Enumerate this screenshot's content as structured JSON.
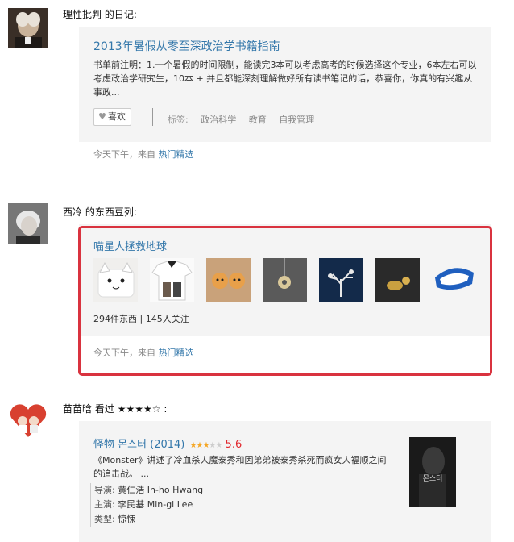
{
  "feed": {
    "item1": {
      "user": "理性批判",
      "action": "的日记:",
      "title": "2013年暑假从零至深政治学书籍指南",
      "desc": "书单前注明：1.一个暑假的时间限制，能读完3本可以考虑高考的时候选择这个专业，6本左右可以考虑政治学研究生，10本 + 并且都能深刻理解做好所有读书笔记的话，恭喜你，你真的有兴趣从事政...",
      "like_label": "喜欢",
      "tags_label": "标签:",
      "tags": [
        "政治科学",
        "教育",
        "自我管理"
      ],
      "time": "今天下午，来自",
      "source": "热门精选"
    },
    "item2": {
      "user": "西冷",
      "action": "的东西豆列:",
      "title": "喵星人拯救地球",
      "stats": "294件东西 | 145人关注",
      "time": "今天下午，来自",
      "source": "热门精选",
      "highlight_color": "#d9333f"
    },
    "item3": {
      "user": "苗苗晗",
      "action": "看过",
      "user_stars": "★★★★☆",
      "colon": ":",
      "title": "怪物 몬스터 (2014)",
      "rating_stars_on": "★★★",
      "rating_stars_off": "★★",
      "rating": "5.6",
      "desc": "《Monster》讲述了冷血杀人魔泰秀和因弟弟被泰秀杀死而疯女人福顺之间的追击战。 ...",
      "director_k": "导演:",
      "director_v": "黄仁浩 In-ho Hwang",
      "cast_k": "主演:",
      "cast_v": "李民基 Min-gi Lee",
      "genre_k": "类型:",
      "genre_v": "惊悚",
      "poster_text": "몬스터"
    }
  },
  "colors": {
    "link": "#3377aa",
    "rating": "#e1262c",
    "star": "#f5a623"
  }
}
